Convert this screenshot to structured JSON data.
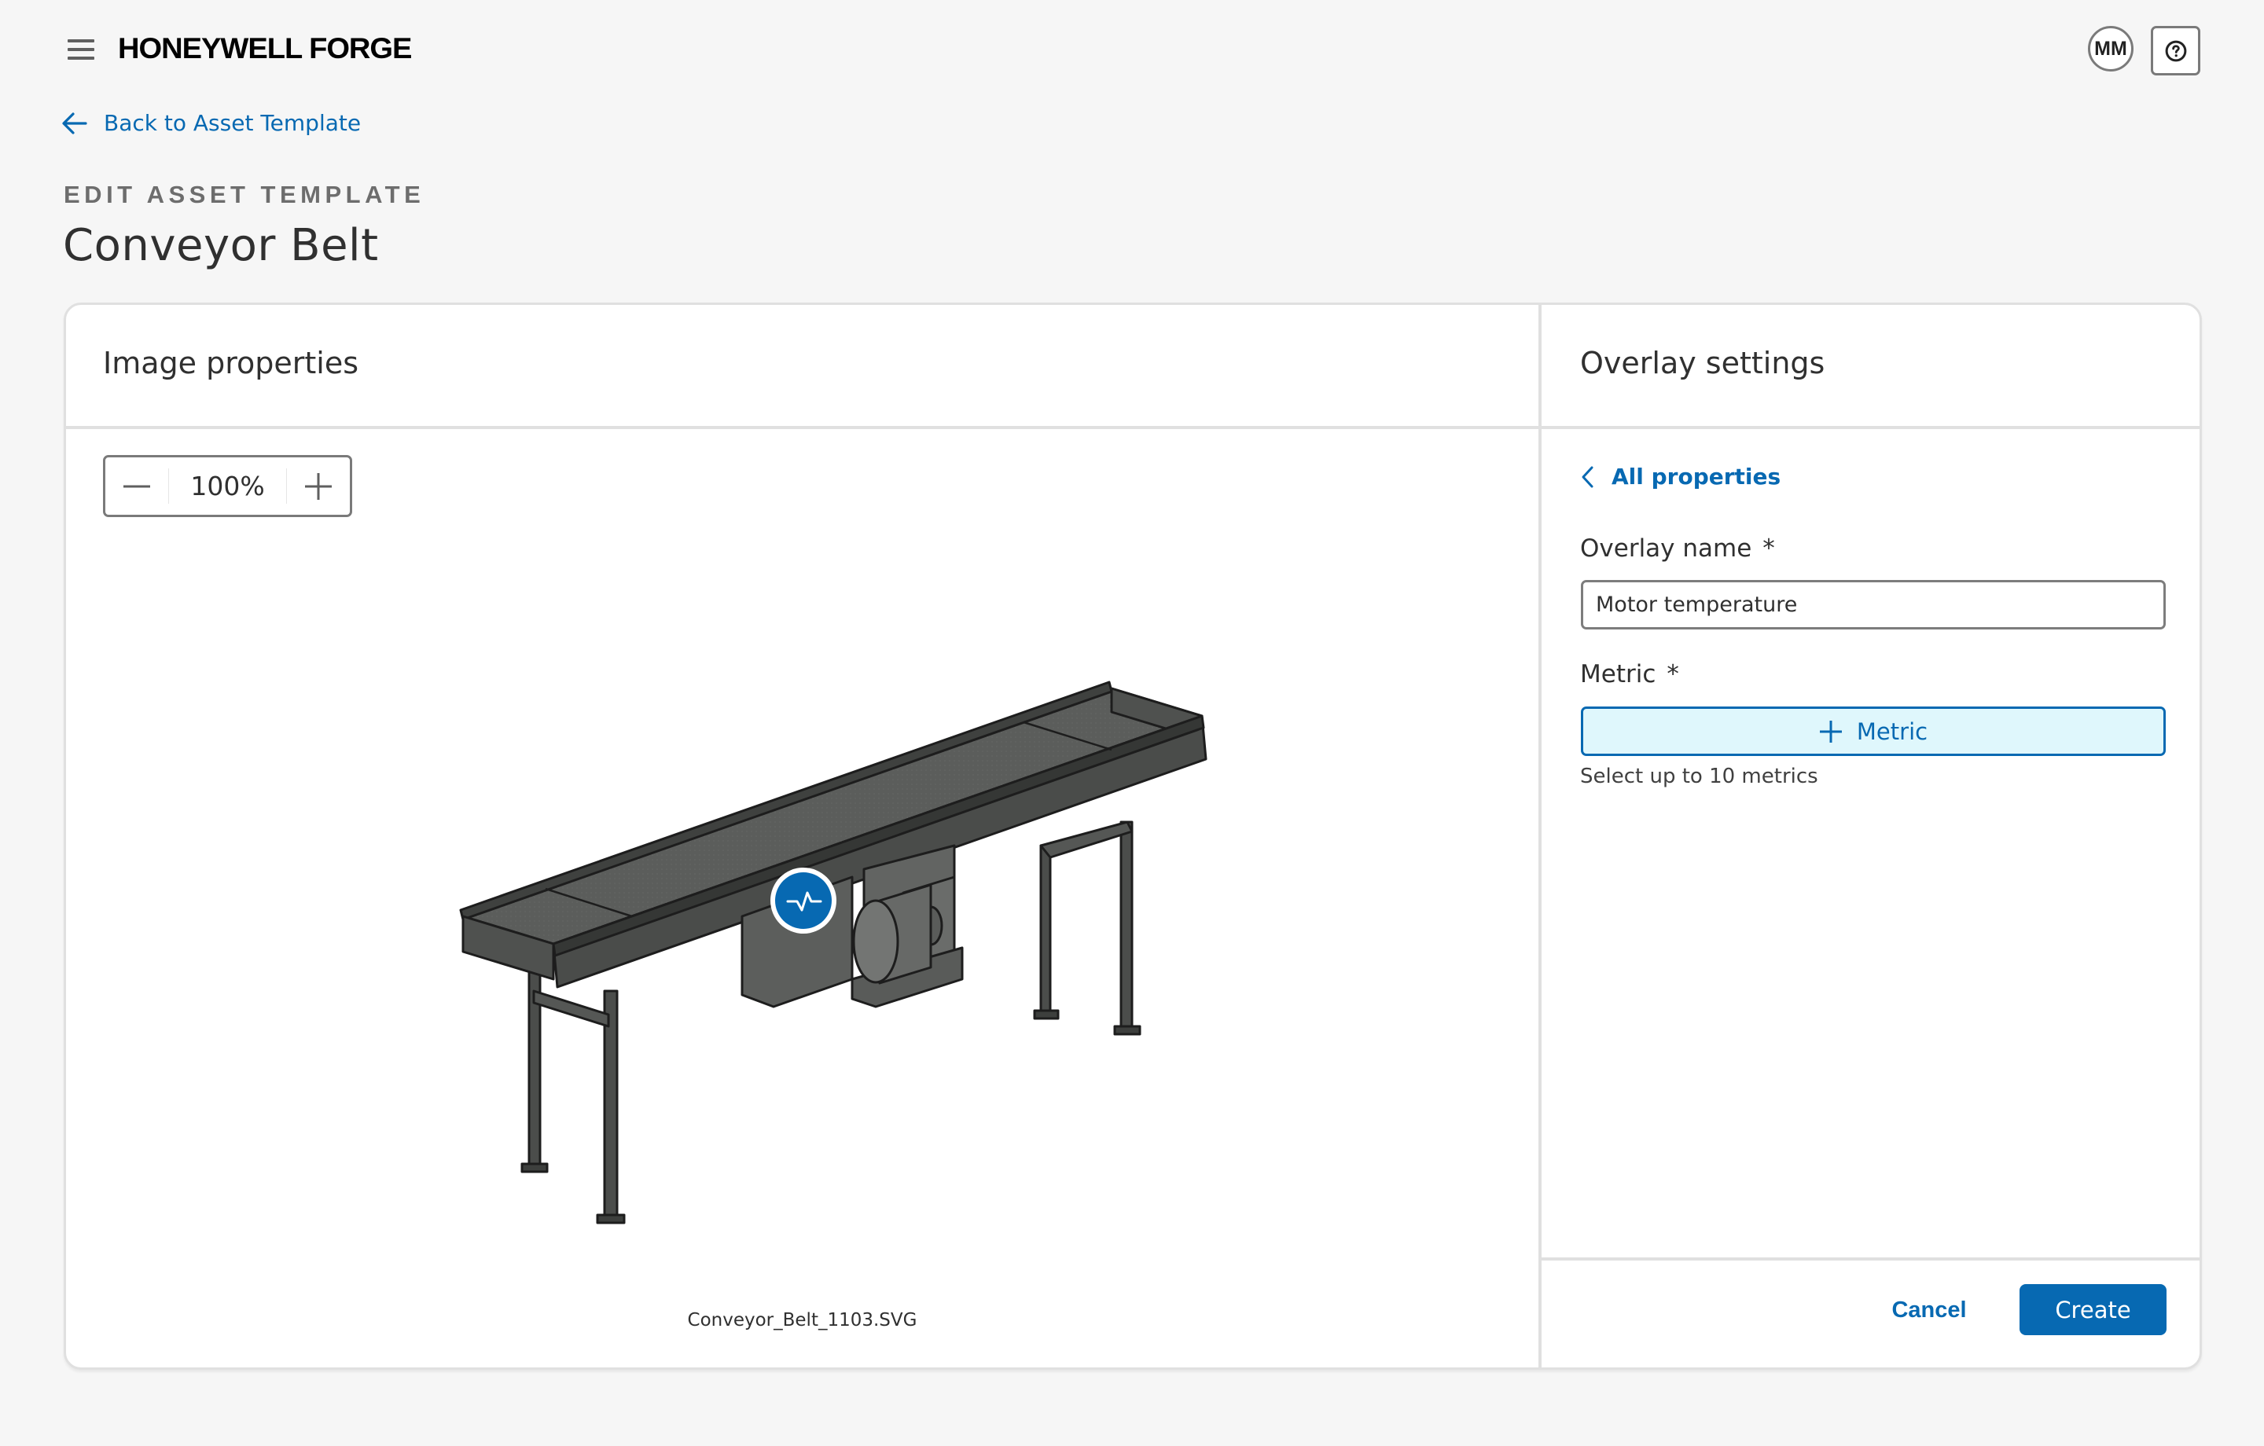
{
  "app": {
    "brand": "HONEYWELL FORGE",
    "user_initials": "MM",
    "icons": {
      "menu": "hamburger-icon",
      "help": "help-circle-icon",
      "back": "arrow-left-icon"
    }
  },
  "nav": {
    "back_label": "Back to Asset Template"
  },
  "page": {
    "eyebrow": "EDIT ASSET TEMPLATE",
    "title": "Conveyor Belt"
  },
  "image_panel": {
    "title": "Image properties",
    "zoom_value": "100%",
    "zoom_out_icon": "minus-icon",
    "zoom_in_icon": "plus-icon",
    "filename": "Conveyor_Belt_1103.SVG",
    "overlay_marker_icon": "pulse-icon"
  },
  "overlay_panel": {
    "title": "Overlay settings",
    "back_label": "All properties",
    "overlay_name_label": "Overlay name",
    "required_mark": "*",
    "overlay_name_value": "Motor temperature",
    "metric_label": "Metric",
    "add_metric_label": "Metric",
    "metric_helper": "Select up to 10 metrics",
    "cancel_label": "Cancel",
    "create_label": "Create"
  },
  "colors": {
    "accent": "#0769b2",
    "metric_button_bg": "#dff7fc",
    "page_bg": "#f6f6f6",
    "border": "#e0e0e0"
  }
}
